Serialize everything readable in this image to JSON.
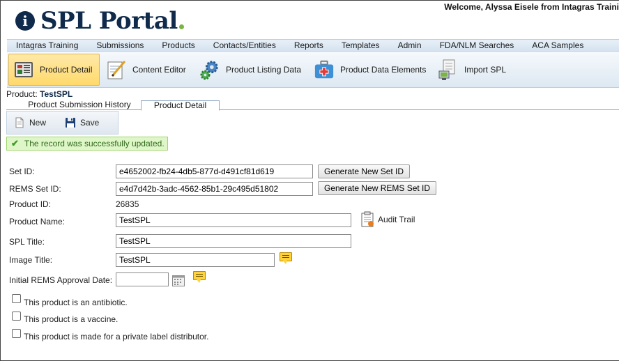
{
  "header": {
    "logo_letter": "i",
    "logo_text": "SPL Portal",
    "welcome": "Welcome, Alyssa Eisele from Intagras Traini"
  },
  "menu": [
    "Intagras Training",
    "Submissions",
    "Products",
    "Contacts/Entities",
    "Reports",
    "Templates",
    "Admin",
    "FDA/NLM Searches",
    "ACA Samples"
  ],
  "toolbar": {
    "product_detail": "Product Detail",
    "content_editor": "Content Editor",
    "product_listing_data": "Product Listing Data",
    "product_data_elements": "Product Data Elements",
    "import_spl": "Import SPL"
  },
  "product_line": {
    "label": "Product:",
    "name": "TestSPL"
  },
  "tabs": {
    "history": "Product Submission History",
    "detail": "Product Detail"
  },
  "actions": {
    "new": "New",
    "save": "Save"
  },
  "success_message": "The record was successfully updated.",
  "form": {
    "set_id_label": "Set ID:",
    "set_id_value": "e4652002-fb24-4db5-877d-d491cf81d619",
    "generate_set_id": "Generate New Set ID",
    "rems_set_id_label": "REMS Set ID:",
    "rems_set_id_value": "e4d7d42b-3adc-4562-85b1-29c495d51802",
    "generate_rems_set_id": "Generate New REMS Set ID",
    "product_id_label": "Product ID:",
    "product_id_value": "26835",
    "product_name_label": "Product Name:",
    "product_name_value": "TestSPL",
    "audit_trail": "Audit Trail",
    "spl_title_label": "SPL Title:",
    "spl_title_value": "TestSPL",
    "image_title_label": "Image Title:",
    "image_title_value": "TestSPL",
    "rems_date_label": "Initial REMS Approval Date:",
    "rems_date_value": "",
    "antibiotic_label": "This product is an antibiotic.",
    "vaccine_label": "This product is a vaccine.",
    "private_label": "This product is made for a private label distributor."
  }
}
